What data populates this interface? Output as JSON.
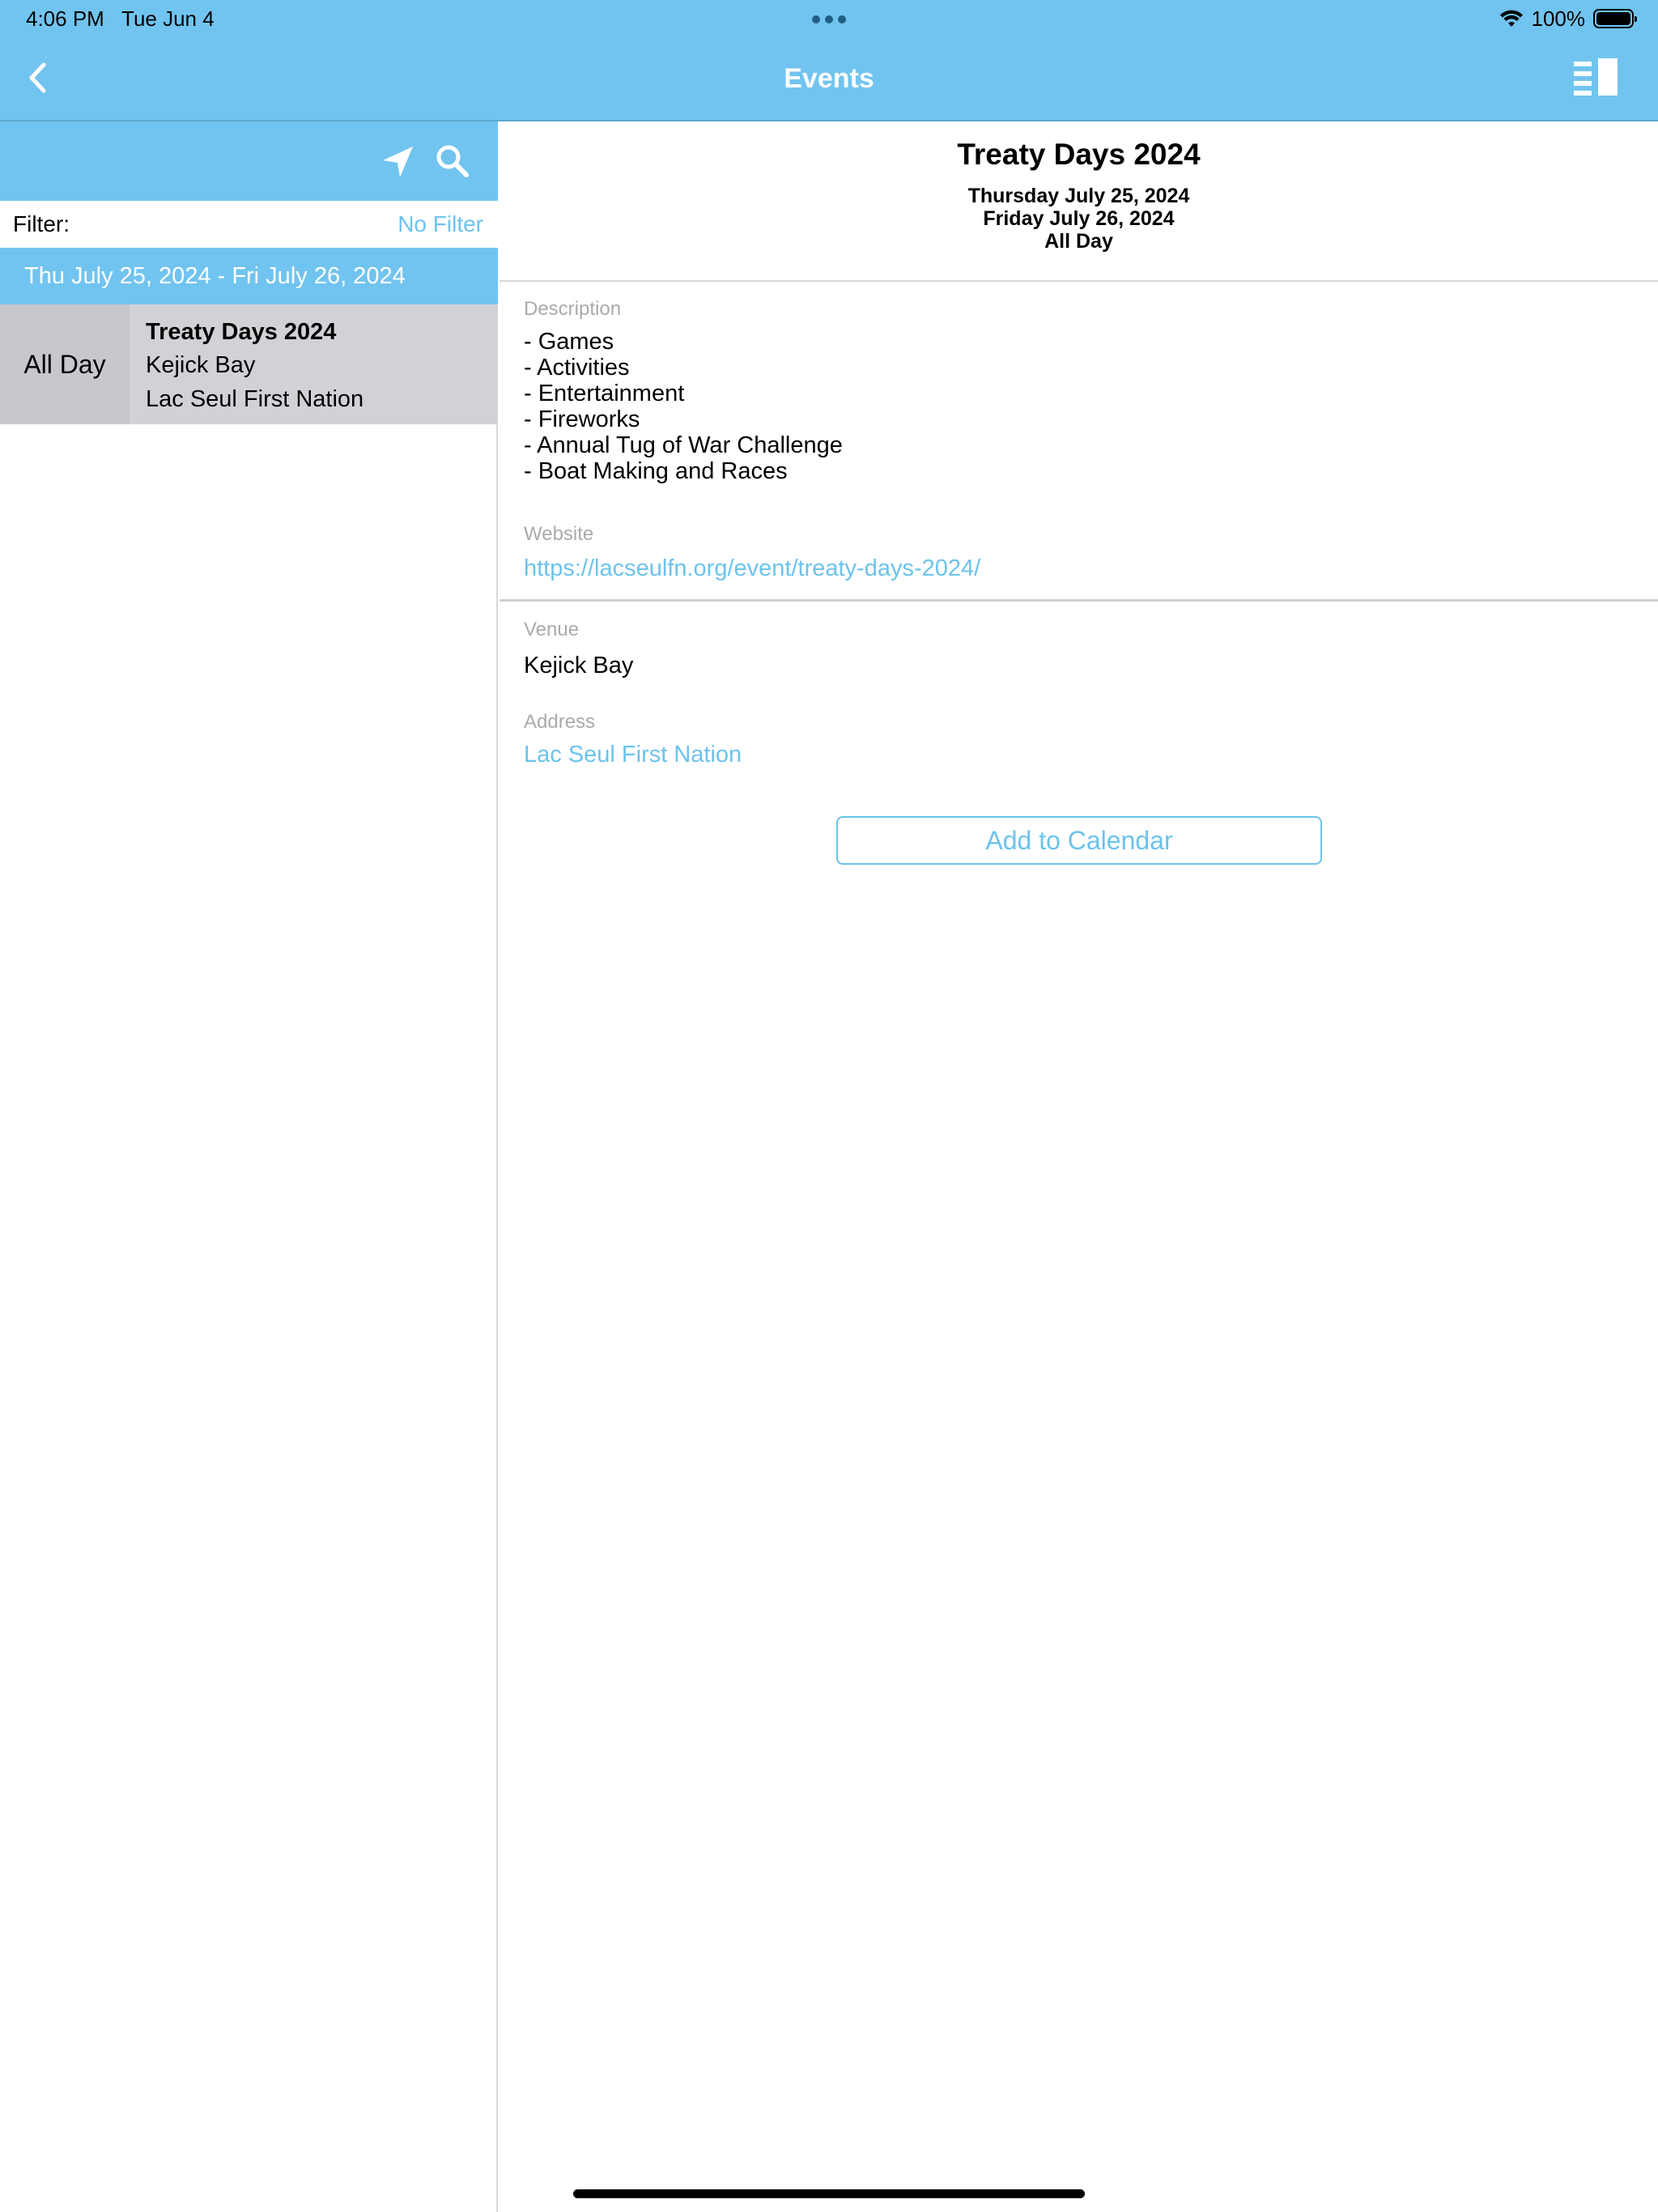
{
  "status_bar": {
    "time": "4:06 PM",
    "date": "Tue Jun 4",
    "battery_percent": "100%",
    "icons": [
      "multitask-dots-icon",
      "wifi-icon",
      "battery-icon"
    ]
  },
  "nav": {
    "title": "Events",
    "back_icon": "chevron-left-icon",
    "split_icon": "sidebar-toggle-icon"
  },
  "left_panel": {
    "toolbar_icons": [
      "location-arrow-icon",
      "search-icon"
    ],
    "filter_label": "Filter:",
    "filter_value": "No Filter",
    "date_range": "Thu July 25, 2024 - Fri July 26, 2024",
    "events": [
      {
        "time": "All Day",
        "name": "Treaty Days 2024",
        "venue": "Kejick Bay",
        "address": "Lac Seul First Nation"
      }
    ]
  },
  "detail": {
    "title": "Treaty Days 2024",
    "dates": [
      "Thursday July 25, 2024",
      "Friday July 26, 2024",
      "All Day"
    ],
    "description_label": "Description",
    "description_lines": [
      "- Games",
      "- Activities",
      "- Entertainment",
      "- Fireworks",
      "- Annual Tug of War Challenge",
      "- Boat Making and Races"
    ],
    "website_label": "Website",
    "website_url": "https://lacseulfn.org/event/treaty-days-2024/",
    "venue_label": "Venue",
    "venue": "Kejick Bay",
    "address_label": "Address",
    "address": "Lac Seul First Nation",
    "add_to_calendar": "Add to Calendar"
  },
  "colors": {
    "accent": "#71c4ef",
    "link": "#6cc3ec",
    "row_bg": "#d1d1d6",
    "label_gray": "#aaaaaa"
  }
}
